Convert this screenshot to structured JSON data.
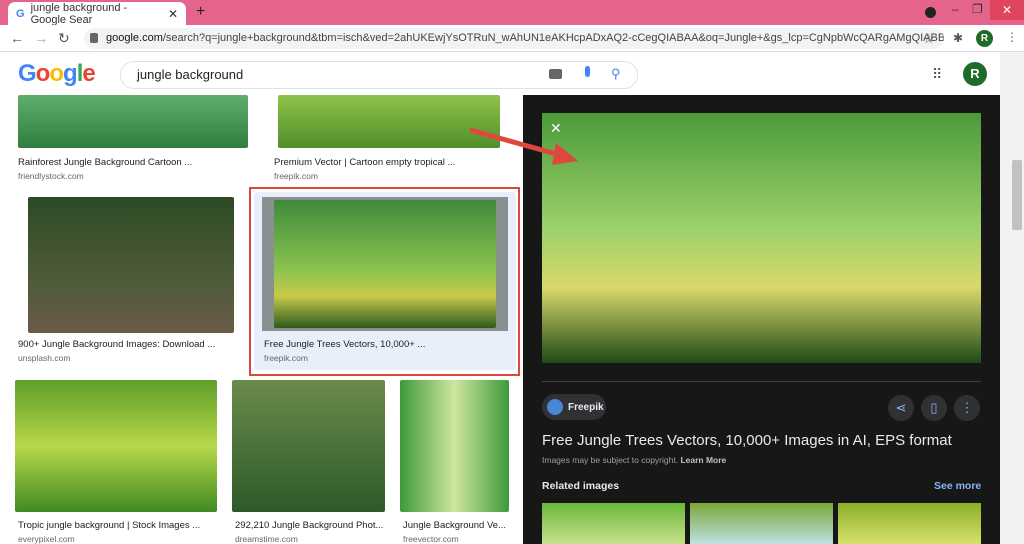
{
  "browser": {
    "tab_title": "jungle background - Google Sear",
    "url_domain": "google.com",
    "url_rest": "/search?q=jungle+background&tbm=isch&ved=2ahUKEwjYsOTRuN_wAhUN1eAKHcpADxAQ2-cCegQIABAA&oq=Jungle+&gs_lcp=CgNpbWcQARgAMgQIABB...",
    "profile_initial": "R"
  },
  "search": {
    "logo": "Google",
    "query": "jungle background"
  },
  "results": [
    {
      "caption": "Rainforest Jungle Background Cartoon ...",
      "source": "friendlystock.com"
    },
    {
      "caption": "Premium Vector | Cartoon empty tropical ...",
      "source": "freepik.com"
    },
    {
      "caption": "900+ Jungle Background Images: Download ...",
      "source": "unsplash.com"
    },
    {
      "caption": "Free Jungle Trees Vectors, 10,000+ ...",
      "source": "freepik.com"
    },
    {
      "caption": "Tropic jungle background | Stock Images ...",
      "source": "everypixel.com"
    },
    {
      "caption": "292,210 Jungle Background Phot...",
      "source": "dreamstime.com"
    },
    {
      "caption": "Jungle Background Ve...",
      "source": "freevector.com"
    }
  ],
  "preview": {
    "site": "Freepik",
    "title": "Free Jungle Trees Vectors, 10,000+ Images in AI, EPS format",
    "copyright": "Images may be subject to copyright.",
    "learn_more": "Learn More",
    "related": "Related images",
    "see_more": "See more"
  },
  "colors": {
    "tab_bar": "#e4648c",
    "panel": "#171717",
    "highlight": "#e0473c",
    "link": "#8ab4f8"
  }
}
